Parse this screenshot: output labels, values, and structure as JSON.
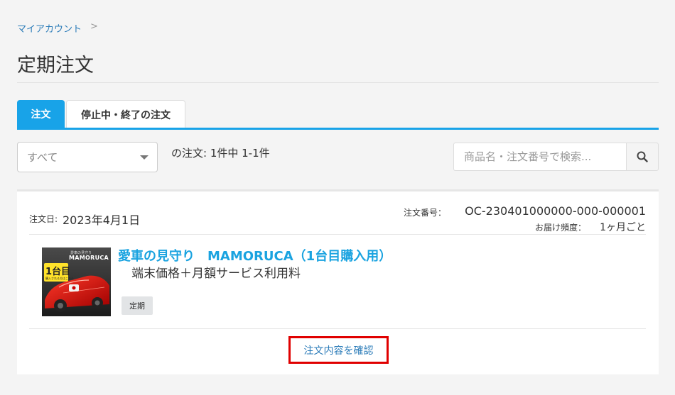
{
  "breadcrumb": {
    "my_account": "マイアカウント",
    "separator": ">"
  },
  "page": {
    "title": "定期注文"
  },
  "tabs": [
    {
      "label": "注文",
      "active": true
    },
    {
      "label": "停止中・終了の注文",
      "active": false
    }
  ],
  "filter": {
    "selected": "すべて"
  },
  "order_count": "の注文: 1件中 1-1件",
  "search": {
    "placeholder": "商品名・注文番号で検索...",
    "icon": "search-icon"
  },
  "order": {
    "date_label": "注文日:",
    "date_value": "2023年4月1日",
    "number_label": "注文番号：",
    "number_value": "OC-230401000000-000-000001",
    "delivery_label": "お届け頻度：",
    "delivery_value": "1ヶ月ごと",
    "product_name": "愛車の見守り　MAMORUCA（1台目購入用）",
    "product_desc": "端末価格＋月額サービス利用料",
    "badge": "定期",
    "thumb": {
      "brand_small": "愛車の見守り",
      "brand": "MAMORUCA",
      "tag": "1台目",
      "tag_sub": "購入される方はこちら"
    },
    "view_link": "注文内容を確認"
  },
  "colors": {
    "accent": "#18a3e8",
    "link": "#2a7bb8",
    "highlight": "#e00000"
  }
}
